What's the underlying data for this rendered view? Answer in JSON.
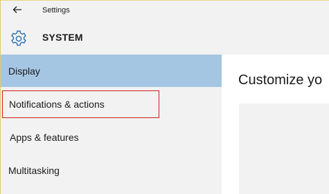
{
  "titlebar": {
    "back_icon": "back-arrow-icon",
    "title": "Settings"
  },
  "header": {
    "icon": "gear-icon",
    "section": "SYSTEM"
  },
  "sidebar": {
    "items": [
      {
        "label": "Display",
        "selected": true
      },
      {
        "label": "Notifications & actions",
        "selected": false,
        "highlighted": true
      },
      {
        "label": "Apps & features",
        "selected": false
      },
      {
        "label": "Multitasking",
        "selected": false
      }
    ]
  },
  "main": {
    "title": "Customize yo"
  },
  "colors": {
    "selected_bg": "#a5c6e3",
    "accent_icon": "#2b6cb0",
    "highlight_border": "#d11a1a",
    "panel_bg": "#f2f2f2"
  }
}
